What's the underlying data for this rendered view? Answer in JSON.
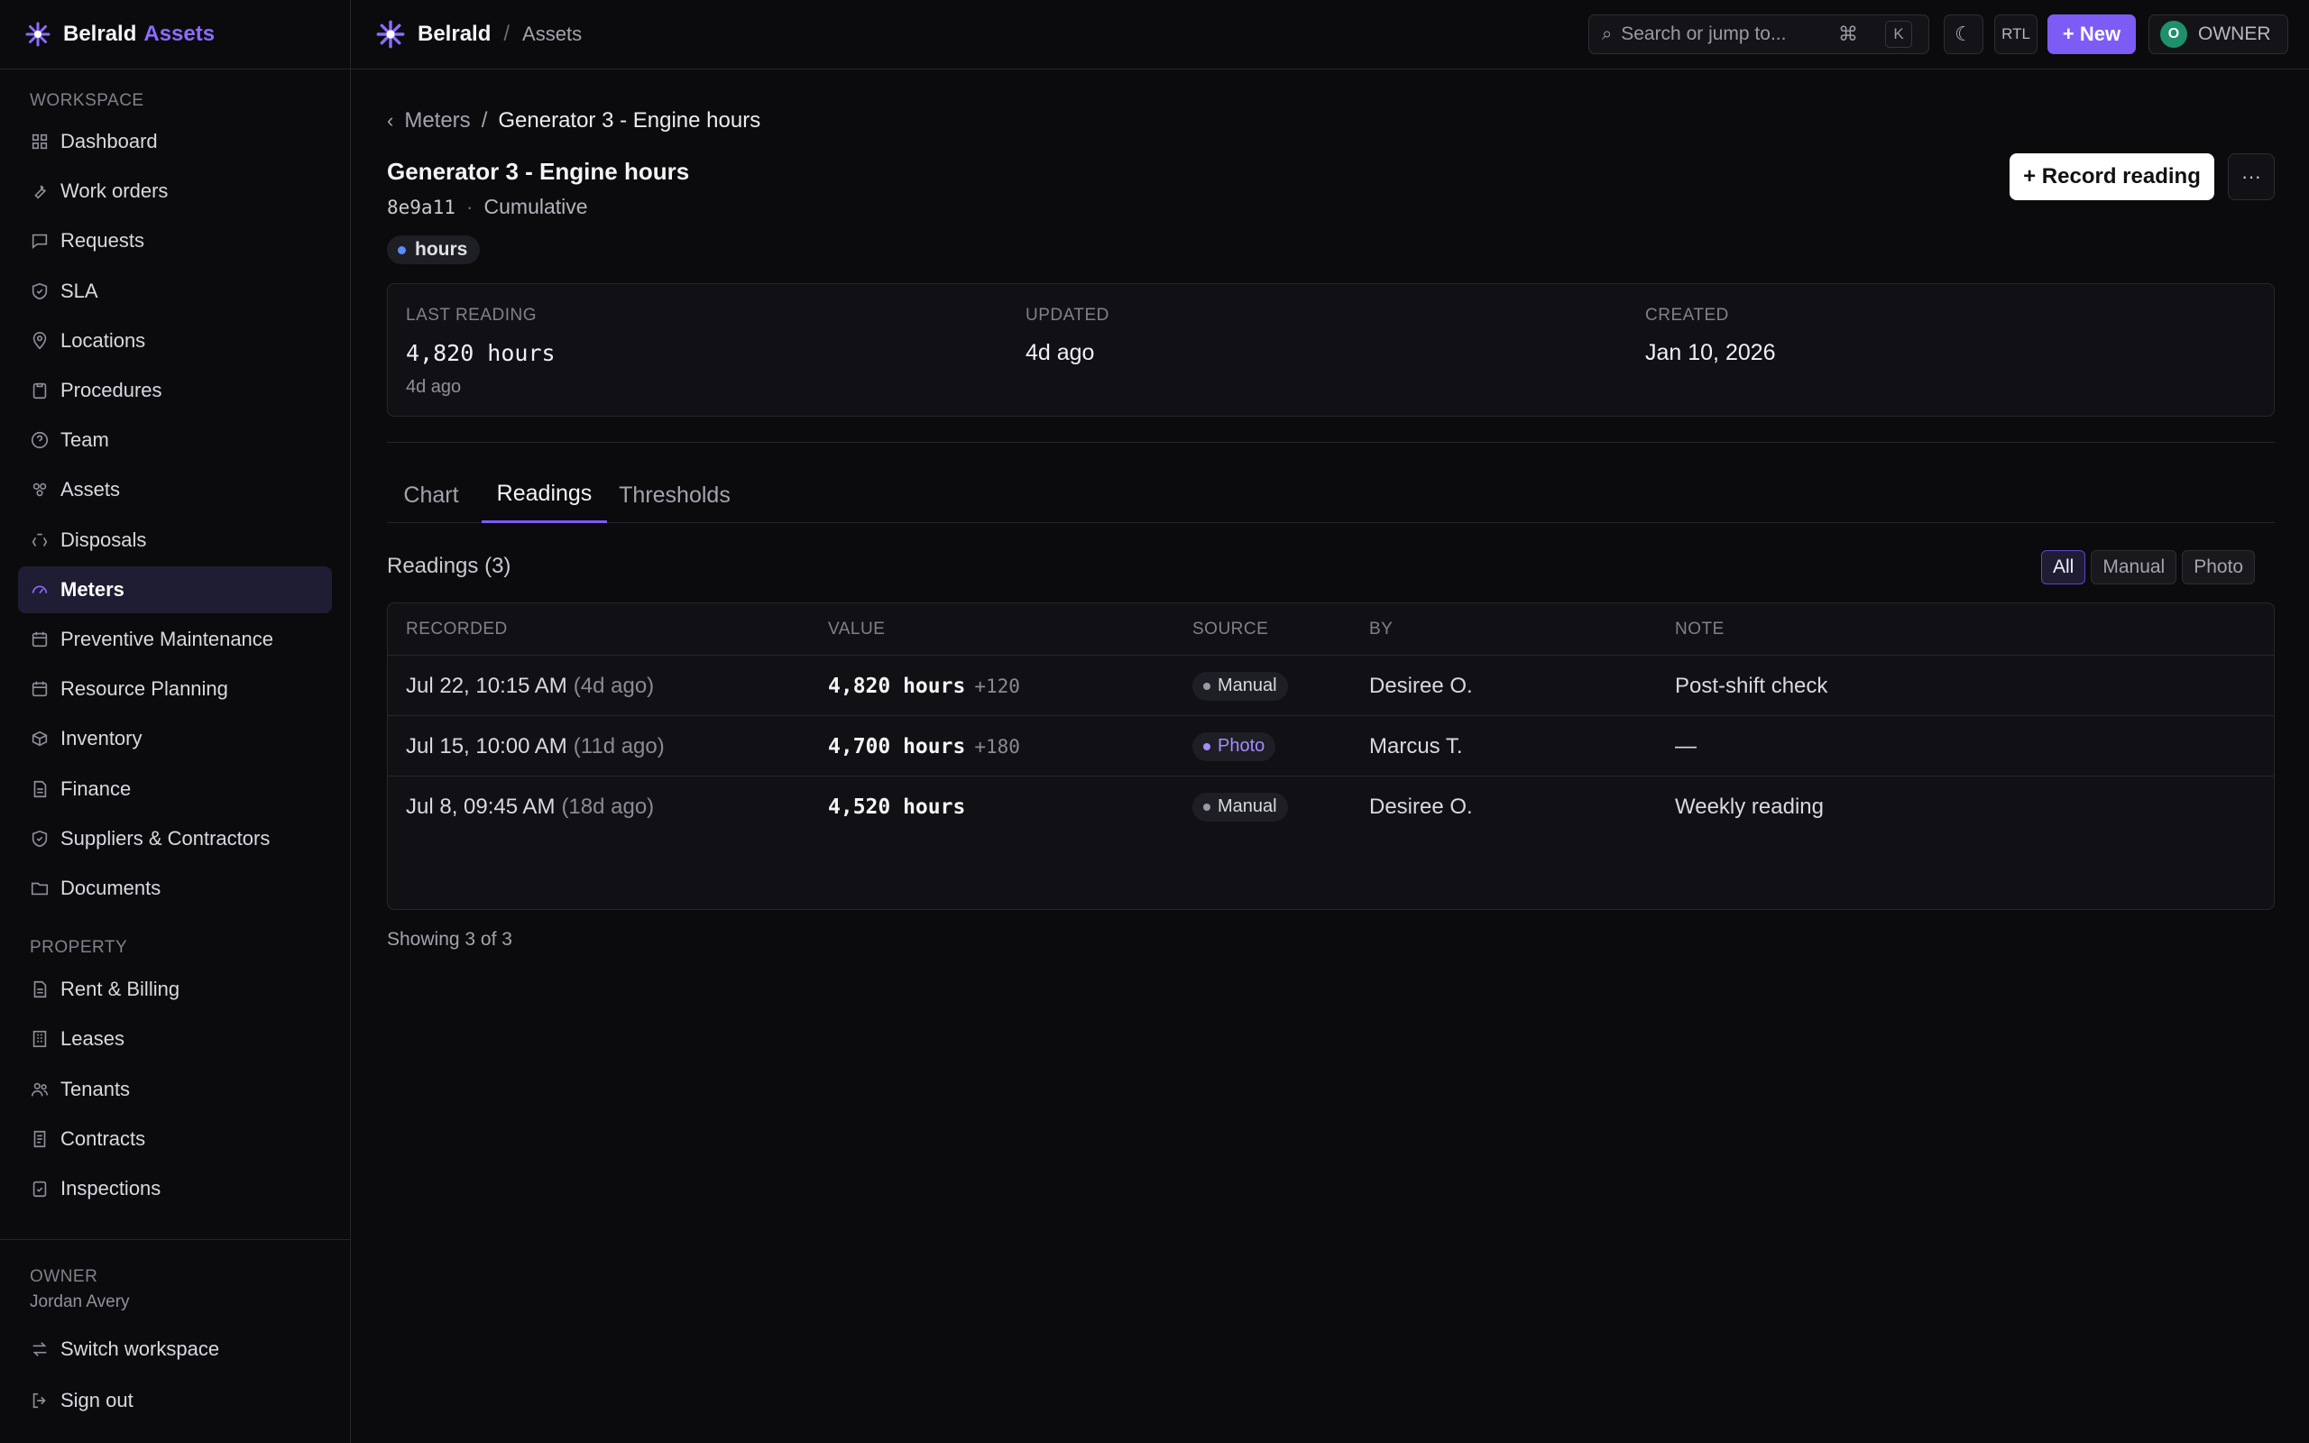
{
  "brand": {
    "name": "Belrald",
    "product": "Assets"
  },
  "sidebar": {
    "workspace_label": "WORKSPACE",
    "workspace_items": [
      {
        "label": "Dashboard",
        "icon": "grid-icon"
      },
      {
        "label": "Work orders",
        "icon": "wrench-icon"
      },
      {
        "label": "Requests",
        "icon": "message-icon"
      },
      {
        "label": "SLA",
        "icon": "shield-icon"
      },
      {
        "label": "Locations",
        "icon": "pin-icon"
      },
      {
        "label": "Procedures",
        "icon": "clipboard-icon"
      },
      {
        "label": "Team",
        "icon": "question-circle-icon"
      },
      {
        "label": "Assets",
        "icon": "assets-icon"
      },
      {
        "label": "Disposals",
        "icon": "recycle-icon"
      },
      {
        "label": "Meters",
        "icon": "gauge-icon",
        "active": true
      },
      {
        "label": "Preventive Maintenance",
        "icon": "calendar-icon"
      },
      {
        "label": "Resource Planning",
        "icon": "calendar-icon"
      },
      {
        "label": "Inventory",
        "icon": "box-icon"
      },
      {
        "label": "Finance",
        "icon": "document-icon"
      },
      {
        "label": "Suppliers & Contractors",
        "icon": "shield-icon"
      },
      {
        "label": "Documents",
        "icon": "folder-icon"
      }
    ],
    "property_label": "PROPERTY",
    "property_items": [
      {
        "label": "Rent & Billing",
        "icon": "document-icon"
      },
      {
        "label": "Leases",
        "icon": "building-icon"
      },
      {
        "label": "Tenants",
        "icon": "users-icon"
      },
      {
        "label": "Contracts",
        "icon": "contract-icon"
      },
      {
        "label": "Inspections",
        "icon": "clipboard-check-icon"
      }
    ],
    "footer": {
      "role": "OWNER",
      "user": "Jordan Avery",
      "switch_label": "Switch workspace",
      "signout_label": "Sign out"
    }
  },
  "topbar": {
    "org": "Belrald",
    "page": "Assets",
    "search_placeholder": "Search or jump to...",
    "shortcut_cmd": "⌘",
    "shortcut_key": "K",
    "rtl_label": "RTL",
    "new_label": "+ New",
    "avatar_initial": "O",
    "owner_label": "OWNER"
  },
  "page": {
    "breadcrumb_parent": "Meters",
    "breadcrumb_current": "Generator 3 - Engine hours",
    "title": "Generator 3 - Engine hours",
    "id": "8e9a11",
    "type": "Cumulative",
    "unit_badge": "hours",
    "record_button": "+ Record reading",
    "more_button": "···"
  },
  "stats": {
    "last_reading_label": "LAST READING",
    "last_reading_value": "4,820 hours",
    "last_reading_sub": "4d ago",
    "updated_label": "UPDATED",
    "updated_value": "4d ago",
    "created_label": "CREATED",
    "created_value": "Jan 10, 2026"
  },
  "tabs": [
    "Chart",
    "Readings",
    "Thresholds"
  ],
  "readings": {
    "heading": "Readings (3)",
    "filters": [
      "All",
      "Manual",
      "Photo"
    ],
    "columns": [
      "RECORDED",
      "VALUE",
      "SOURCE",
      "BY",
      "NOTE"
    ],
    "rows": [
      {
        "recorded": "Jul 22, 10:15 AM",
        "relative": "(4d ago)",
        "value": "4,820 hours",
        "delta": "+120",
        "source": "Manual",
        "by": "Desiree O.",
        "note": "Post-shift check"
      },
      {
        "recorded": "Jul 15, 10:00 AM",
        "relative": "(11d ago)",
        "value": "4,700 hours",
        "delta": "+180",
        "source": "Photo",
        "by": "Marcus T.",
        "note": "—"
      },
      {
        "recorded": "Jul 8, 09:45 AM",
        "relative": "(18d ago)",
        "value": "4,520 hours",
        "delta": "",
        "source": "Manual",
        "by": "Desiree O.",
        "note": "Weekly reading"
      }
    ],
    "showing": "Showing 3 of 3"
  },
  "colors": {
    "accent": "#7c5cf5",
    "background": "#0b0b0e",
    "photo": "#a58bff",
    "unit_dot": "#5b8cff"
  }
}
